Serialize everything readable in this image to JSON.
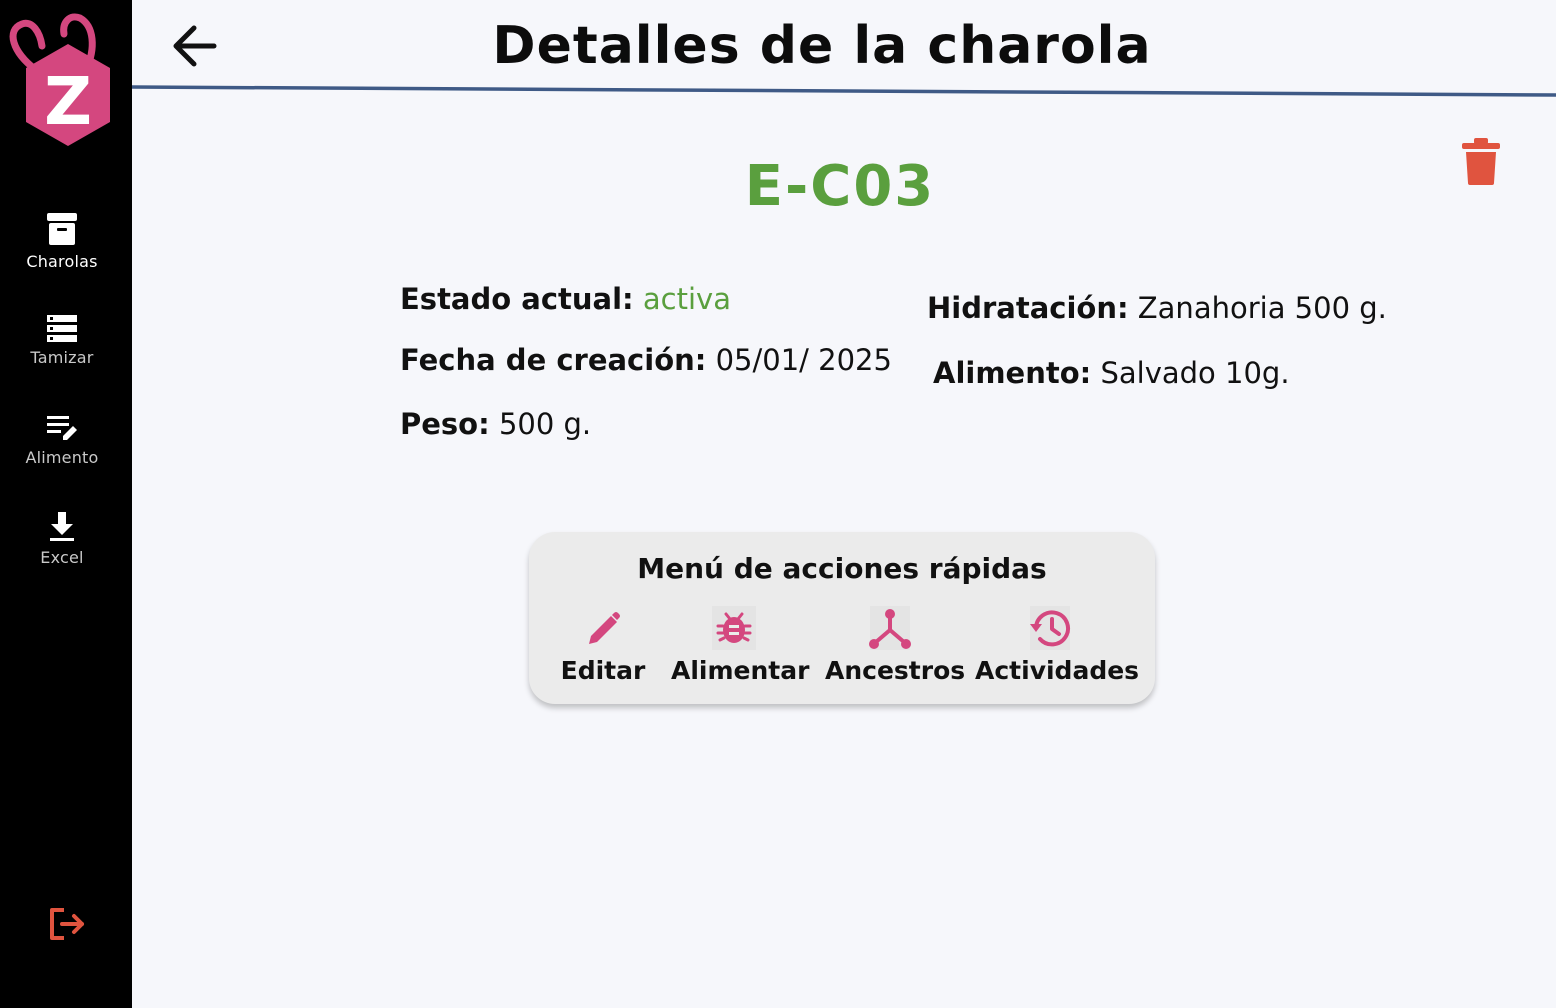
{
  "app": {
    "logo_letter": "Z"
  },
  "sidebar": {
    "items": [
      {
        "label": "Charolas",
        "icon": "archive-box-icon",
        "active": true
      },
      {
        "label": "Tamizar",
        "icon": "server-stack-icon",
        "active": false
      },
      {
        "label": "Alimento",
        "icon": "edit-list-icon",
        "active": false
      },
      {
        "label": "Excel",
        "icon": "download-icon",
        "active": false
      }
    ],
    "logout_icon": "logout-icon"
  },
  "header": {
    "title": "Detalles de la charola",
    "back_icon": "arrow-left-icon"
  },
  "tray": {
    "code": "E-C03",
    "fields": {
      "estado": {
        "label": "Estado actual:",
        "value": "activa"
      },
      "fecha": {
        "label": "Fecha de creación:",
        "value": "05/01/ 2025"
      },
      "peso": {
        "label": "Peso:",
        "value": "500 g."
      },
      "hidratacion": {
        "label": "Hidratación:",
        "value": "Zanahoria 500 g."
      },
      "alimento": {
        "label": "Alimento:",
        "value": "Salvado 10g."
      }
    }
  },
  "quick_actions": {
    "title": "Menú de acciones rápidas",
    "items": [
      {
        "label": "Editar",
        "icon": "pencil-icon"
      },
      {
        "label": "Alimentar",
        "icon": "bug-icon"
      },
      {
        "label": "Ancestros",
        "icon": "family-tree-icon"
      },
      {
        "label": "Actividades",
        "icon": "history-icon"
      }
    ]
  },
  "colors": {
    "accent_pink": "#d4477f",
    "green": "#5a9f3e",
    "danger": "#e0543f",
    "header_line": "#3f5a86",
    "sidebar_bg": "#000000"
  }
}
